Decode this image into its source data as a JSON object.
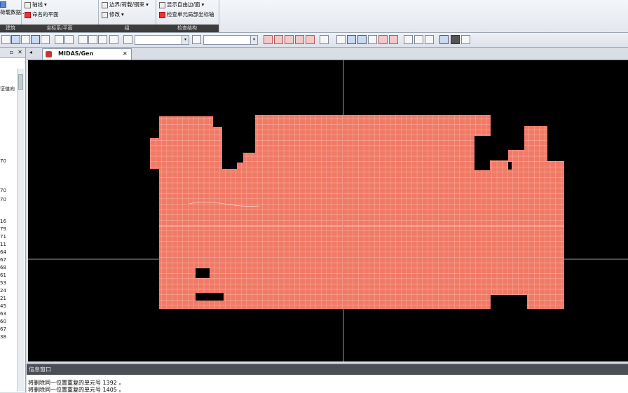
{
  "ribbon": {
    "groups": [
      {
        "items": [
          "荷载数据..."
        ],
        "caption": "建筑"
      },
      {
        "items": [
          "轴线",
          "命名的平面"
        ],
        "caption": "坐标系/平面",
        "arrow": "▾"
      },
      {
        "items": [
          "边界/荷载/钢束",
          "修改"
        ],
        "caption": "组",
        "arrow": "▾"
      },
      {
        "items": [
          "显示自由边/面",
          "检查单元局部坐标轴"
        ],
        "caption": "检查结构",
        "arrow": "▾"
      }
    ]
  },
  "left_panel": {
    "pin": "▫",
    "close": "✕",
    "text_fragment": "证值向",
    "numbers": [
      "70",
      "70",
      "70",
      "16",
      "79",
      "71",
      "11",
      "64",
      "67",
      "68",
      "61",
      "53",
      "24",
      "21",
      "45",
      "63",
      "60",
      "67",
      "38"
    ]
  },
  "tabstrip": {
    "left_arrow": "◂",
    "tab_title": "MIDAS/Gen",
    "tab_close": "✕"
  },
  "model": {
    "mesh_color": "#f07a66",
    "mesh_line_color": "#ffd0c4",
    "axis_color": "#9a9a9a"
  },
  "message_window": {
    "title": "信息窗口",
    "lines": [
      "将删除同一位置重复的单元号 1392 。",
      "将删除同一位置重复的单元号 1405 。"
    ]
  }
}
